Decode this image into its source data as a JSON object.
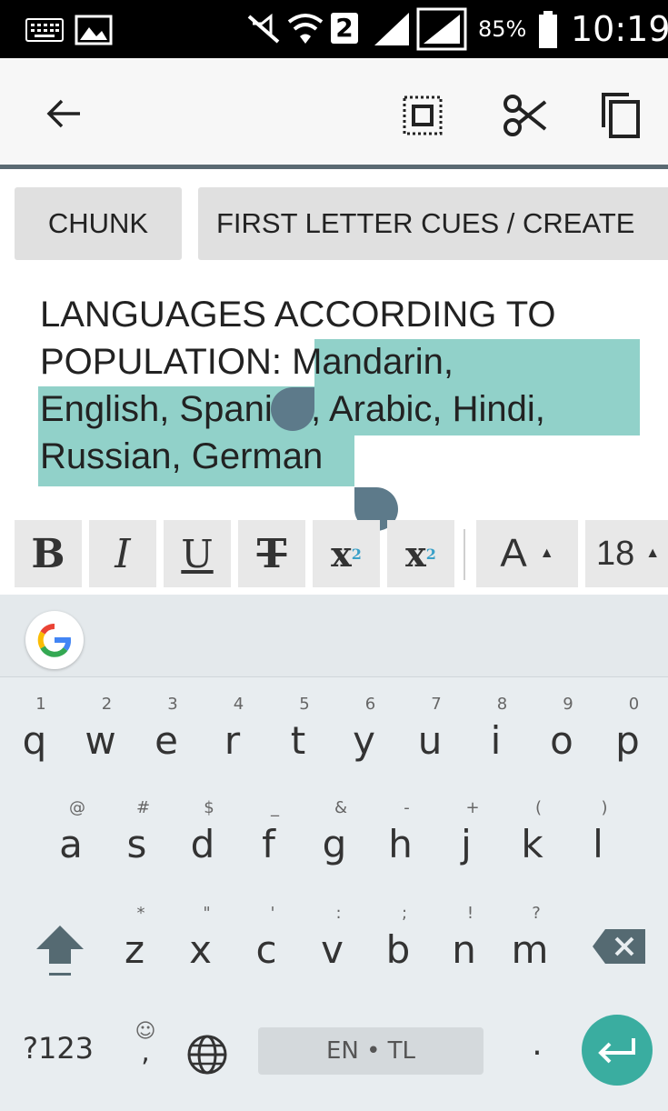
{
  "status_bar": {
    "sim_number": "2",
    "battery": "85%",
    "time": "10:19"
  },
  "toolbar": {
    "back_icon": "arrow-back-icon",
    "select_all_icon": "select-all-icon",
    "cut_icon": "scissors-icon",
    "copy_icon": "copy-icon"
  },
  "chips": {
    "chunk": "CHUNK",
    "first_letter": "FIRST LETTER CUES / CREATE"
  },
  "editor": {
    "line1": "LANGUAGES ACCORDING TO",
    "line2_plain": "POPULATION: ",
    "line2_sel": "Mandarin,",
    "line3": "English, Spanish, Arabic, Hindi,",
    "line4": "Russian, German",
    "selection_color": "#91d1c9"
  },
  "format_bar": {
    "bold": "B",
    "italic": "I",
    "underline": "U",
    "strike": "T",
    "superscript": "x",
    "superscript_mark": "2",
    "subscript": "x",
    "subscript_mark": "2",
    "text_color": "A",
    "font_size": "18"
  },
  "keyboard": {
    "row1": [
      "q",
      "w",
      "e",
      "r",
      "t",
      "y",
      "u",
      "i",
      "o",
      "p"
    ],
    "row1_hints": [
      "1",
      "2",
      "3",
      "4",
      "5",
      "6",
      "7",
      "8",
      "9",
      "0"
    ],
    "row2": [
      "a",
      "s",
      "d",
      "f",
      "g",
      "h",
      "j",
      "k",
      "l"
    ],
    "row2_hints": [
      "@",
      "#",
      "$",
      "_",
      "&",
      "-",
      "+",
      "(",
      ")"
    ],
    "row3": [
      "z",
      "x",
      "c",
      "v",
      "b",
      "n",
      "m"
    ],
    "row3_hints": [
      "*",
      "\"",
      "'",
      ":",
      ";",
      "!",
      "?"
    ],
    "symbols": "?123",
    "emoji_hint": "☺",
    "comma": ",",
    "space": "EN • TL",
    "period": ".",
    "accent_color": "#3aada0"
  }
}
